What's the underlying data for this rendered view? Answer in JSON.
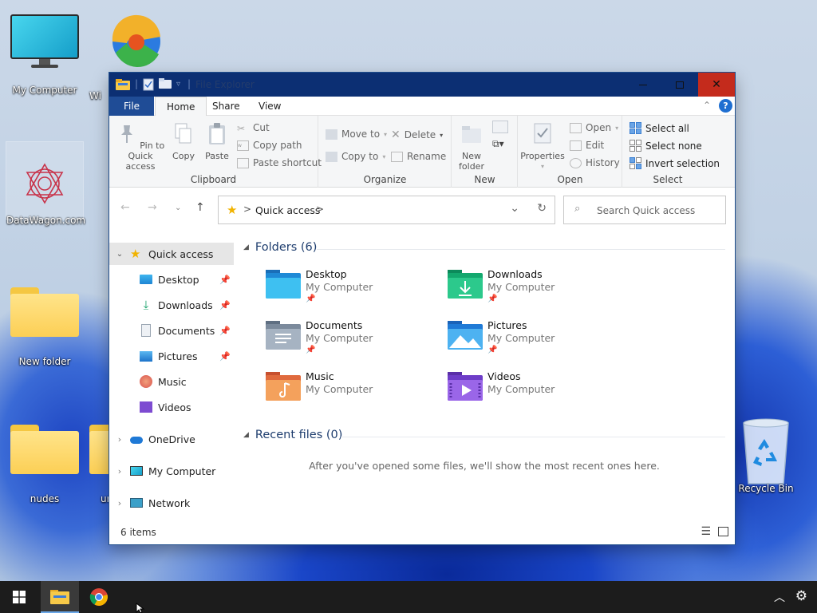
{
  "desktop": {
    "icons": [
      {
        "label": "My Computer"
      },
      {
        "label": "Wi"
      },
      {
        "label": "DataWagon.com"
      },
      {
        "label": "New folder"
      },
      {
        "label": "nudes"
      },
      {
        "label": "ur"
      },
      {
        "label": "Recycle Bin"
      }
    ]
  },
  "window": {
    "title": "File Explorer",
    "controls": {
      "minimize": "—",
      "maximize": "☐",
      "close": "✕"
    }
  },
  "ribbon_tabs": {
    "file": "File",
    "home": "Home",
    "share": "Share",
    "view": "View",
    "help": "?"
  },
  "ribbon": {
    "clipboard": {
      "pin_label": "Pin to Quick access",
      "copy_label": "Copy",
      "paste_label": "Paste",
      "cut_label": "Cut",
      "copy_path_label": "Copy path",
      "paste_shortcut_label": "Paste shortcut",
      "group_label": "Clipboard"
    },
    "organize": {
      "move_to_label": "Move to",
      "copy_to_label": "Copy to",
      "delete_label": "Delete",
      "rename_label": "Rename",
      "group_label": "Organize"
    },
    "new": {
      "new_folder_label": "New folder",
      "group_label": "New"
    },
    "open": {
      "properties_label": "Properties",
      "open_label": "Open",
      "edit_label": "Edit",
      "history_label": "History",
      "group_label": "Open"
    },
    "select": {
      "select_all_label": "Select all",
      "select_none_label": "Select none",
      "invert_selection_label": "Invert selection",
      "group_label": "Select"
    }
  },
  "address": {
    "path": "Quick access",
    "separator": ">"
  },
  "search": {
    "placeholder": "Search Quick access"
  },
  "navpane": {
    "quick_access": "Quick access",
    "items": [
      {
        "label": "Desktop",
        "pinned": true
      },
      {
        "label": "Downloads",
        "pinned": true
      },
      {
        "label": "Documents",
        "pinned": true
      },
      {
        "label": "Pictures",
        "pinned": true
      },
      {
        "label": "Music",
        "pinned": false
      },
      {
        "label": "Videos",
        "pinned": false
      }
    ],
    "onedrive": "OneDrive",
    "my_computer": "My Computer",
    "network": "Network"
  },
  "content": {
    "folders_title": "Folders (6)",
    "folders": [
      {
        "name": "Desktop",
        "location": "My Computer",
        "pinned": true
      },
      {
        "name": "Downloads",
        "location": "My Computer",
        "pinned": true
      },
      {
        "name": "Documents",
        "location": "My Computer",
        "pinned": true
      },
      {
        "name": "Pictures",
        "location": "My Computer",
        "pinned": true
      },
      {
        "name": "Music",
        "location": "My Computer",
        "pinned": false
      },
      {
        "name": "Videos",
        "location": "My Computer",
        "pinned": false
      }
    ],
    "recent_title": "Recent files (0)",
    "recent_empty": "After you've opened some files, we'll show the most recent ones here."
  },
  "statusbar": {
    "items_count": "6 items"
  },
  "colors": {
    "accent": "#1f4c96",
    "titlebar": "#0c2f73",
    "close": "#c42b1c",
    "taskbar": "#1c1c1c"
  }
}
